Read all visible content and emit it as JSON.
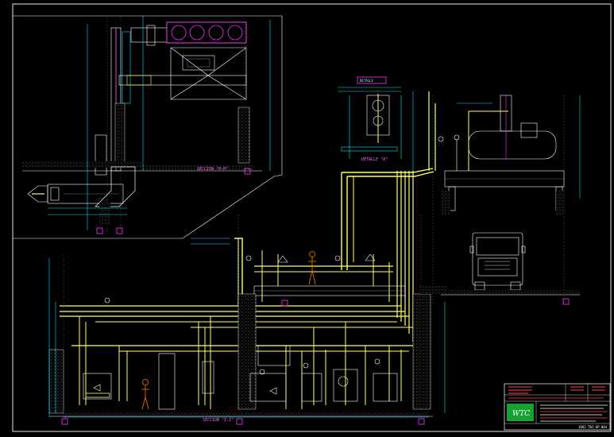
{
  "drawing": {
    "sections": {
      "upper_left": "SECCION \"H-H\"",
      "bottom": "SECCION \"I-I\"",
      "detail": "DETALLE \"A\"",
      "upper_right_tag": "DETALLE"
    },
    "title_block": {
      "logo": "WTC",
      "drawing_number": "1082-TBJ-OP-004"
    }
  },
  "colors": {
    "background": "#000000",
    "border": "#ffffff",
    "pipe_main": "#ffff66",
    "dimension": "#00e5ff",
    "annotation": "#ff33ff",
    "figure": "#ff7a00"
  }
}
